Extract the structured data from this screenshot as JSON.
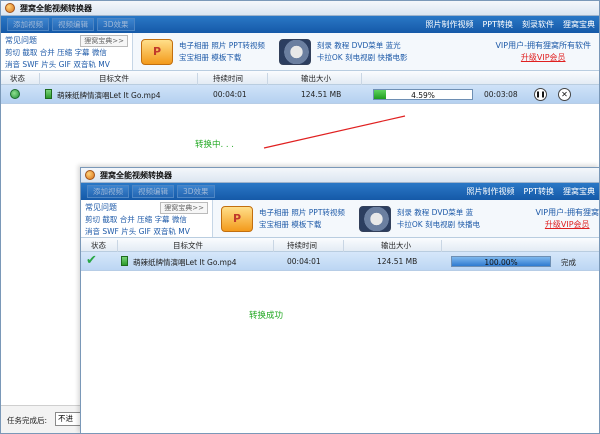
{
  "app": {
    "title": "狸窝全能视频转换器"
  },
  "toolbar": {
    "buttons": [
      "添加视频",
      "视频编辑",
      "3D效果"
    ],
    "links1": [
      "照片制作视频",
      "PPT转换",
      "刻录软件",
      "狸窝宝典"
    ],
    "links2": [
      "照片制作视频",
      "PPT转换",
      "狸窝宝典"
    ]
  },
  "faq": {
    "title": "常见问题",
    "tag": "狸窝宝典>>",
    "line1": "剪切 截取 合并 压缩 字幕 微信",
    "line2": "消音 SWF 片头 GIF 双音轨 MV"
  },
  "promo": {
    "ppt_label": "P",
    "ppt_line1": "电子相册 照片 PPT转视频",
    "ppt_line2": "宝宝相册 模板下载",
    "dvd_line1": "刻录 教程 DVD菜单 蓝光",
    "dvd_line2": "卡拉OK 刻电视剧 快播电影",
    "dvd_line1_b": "刻录 教程 DVD菜单 蓝",
    "dvd_line2_b": "卡拉OK 刻电视剧 快播电"
  },
  "vip": {
    "title": "VIP用户-拥有狸窝所有软件",
    "link": "升级VIP会员",
    "title_b": "VIP用户-拥有狸窝"
  },
  "columns": {
    "status": "状态",
    "target": "目标文件",
    "duration": "持续时间",
    "size": "输出大小"
  },
  "task1": {
    "filename": "萌辣纸牌情演唱Let It Go.mp4",
    "duration": "00:04:01",
    "size": "124.51 MB",
    "progress_percent": 4.59,
    "progress_text": "4.59%",
    "remaining": "00:03:08",
    "pause_glyph": "❚❚",
    "close_glyph": "✕"
  },
  "task2": {
    "filename": "萌辣纸牌情演唱Let It Go.mp4",
    "duration": "00:04:01",
    "size": "124.51 MB",
    "progress_percent": 100,
    "progress_text": "100.00%",
    "status_text": "完成",
    "check_glyph": "✔"
  },
  "annotations": {
    "converting": "转换中. . .",
    "success": "转换成功"
  },
  "footer": {
    "label": "任务完成后:",
    "select_value": "不进"
  },
  "colors": {
    "toolbar": "#1b63b4",
    "row": "#c4dbf4",
    "arrow": "#e02020",
    "note": "#22a822",
    "vip_link": "#e02020"
  },
  "icons": {
    "app": "fox-logo-icon",
    "status_running": "spinner-icon",
    "status_done": "check-icon",
    "file": "file-video-icon"
  }
}
